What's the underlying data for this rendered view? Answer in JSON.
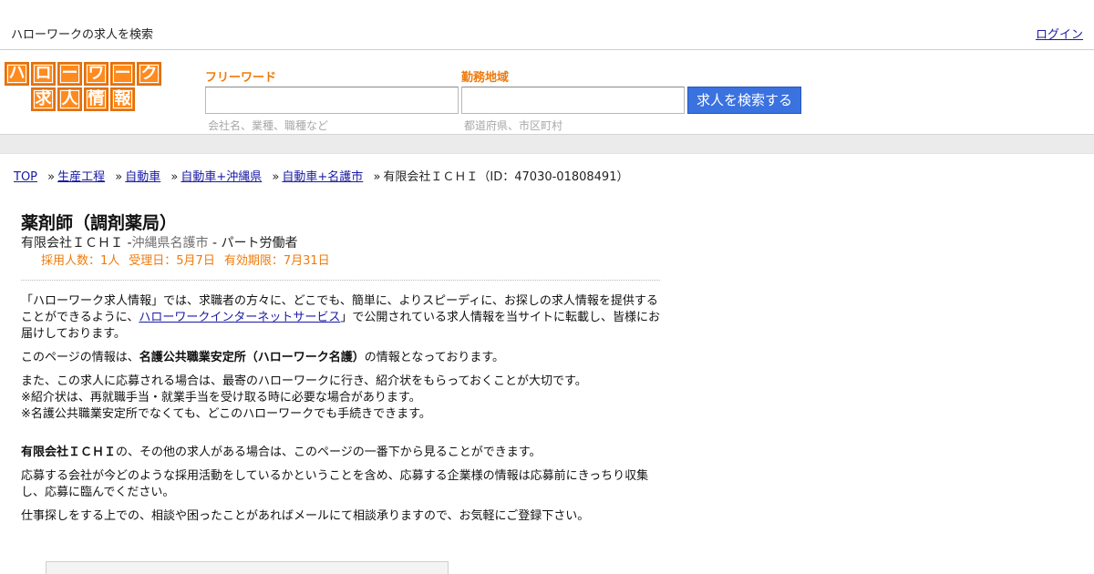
{
  "topbar": {
    "site_desc": "ハローワークの求人を検索",
    "login": "ログイン"
  },
  "logo": {
    "row1": [
      "ハ",
      "ロ",
      "ー",
      "ワ",
      "ー",
      "ク"
    ],
    "row2": [
      "求",
      "人",
      "情",
      "報"
    ],
    "color": "#ff8a1e"
  },
  "search": {
    "free_word_label": "フリーワード",
    "free_word_value": "",
    "free_word_hint": "会社名、業種、職種など",
    "area_label": "勤務地域",
    "area_value": "",
    "area_hint": "都道府県、市区町村",
    "button_label": "求人を検索する",
    "button_color": "#3a72e0"
  },
  "breadcrumb": {
    "items": [
      "TOP",
      "生産工程",
      "自動車",
      "自動車+沖縄県",
      "自動車+名護市"
    ],
    "separator": "»",
    "current": "有限会社ＩＣＨＩ（ID：47030-01808491）"
  },
  "job": {
    "title": "薬剤師（調剤薬局）",
    "company": "有限会社ＩＣＨＩ",
    "company_sep": " -",
    "location": "沖縄県名護市",
    "employment": " - パート労働者",
    "hires": "採用人数：1人",
    "received": "受理日：5月7日",
    "expires": "有効期限：7月31日",
    "accent_color": "#f07a0c"
  },
  "body": {
    "p1_a": "「ハローワーク求人情報」では、求職者の方々に、どこでも、簡単に、よりスピーディに、お探しの求人情報を提供することができるように、",
    "p1_link": "ハローワークインターネットサービス",
    "p1_b": "」で公開されている求人情報を当サイトに転載し、皆様にお届けしております。",
    "p2_a": "このページの情報は、",
    "p2_bold": "名護公共職業安定所（ハローワーク名護）",
    "p2_b": "の情報となっております。",
    "p3_l1": "また、この求人に応募される場合は、最寄のハローワークに行き、紹介状をもらっておくことが大切です。",
    "p3_l2": "※紹介状は、再就職手当・就業手当を受け取る時に必要な場合があります。",
    "p3_l3": "※名護公共職業安定所でなくても、どこのハローワークでも手続きできます。",
    "p4_bold": "有限会社ＩＣＨＩ",
    "p4_b": "の、その他の求人がある場合は、このページの一番下から見ることができます。",
    "p5": "応募する会社が今どのような採用活動をしているかということを含め、応募する企業様の情報は応募前にきっちり収集し、応募に臨んでください。",
    "p6": "仕事探しをする上での、相談や困ったことがあればメールにて相談承りますので、お気軽にご登録下さい。"
  }
}
